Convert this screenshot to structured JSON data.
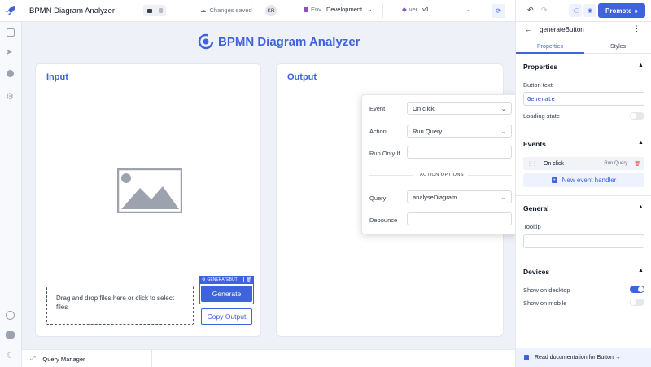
{
  "app": {
    "title": "BPMN Diagram Analyzer",
    "changes_status": "Changes saved",
    "user_initials": "KR"
  },
  "env": {
    "label": "Env",
    "value": "Development"
  },
  "version": {
    "label": "ver",
    "value": "v1"
  },
  "promote": {
    "label": "Promote"
  },
  "canvas": {
    "header_title": "BPMN Diagram Analyzer",
    "input_title": "Input",
    "output_title": "Output",
    "dropzone_text": "Drag and drop files here or click to select files",
    "component_tag": "GENERATEBUT",
    "generate_label": "Generate",
    "copy_label": "Copy Output"
  },
  "event_popover": {
    "event_label": "Event",
    "event_value": "On click",
    "action_label": "Action",
    "action_value": "Run Query",
    "run_only_if_label": "Run Only If",
    "action_options_label": "ACTION OPTIONS",
    "query_label": "Query",
    "query_value": "analyseDiagram",
    "debounce_label": "Debounce"
  },
  "bottom": {
    "query_manager": "Query Manager"
  },
  "inspector": {
    "component_name": "generateButton",
    "tabs": [
      {
        "label": "Properties"
      },
      {
        "label": "Styles"
      }
    ],
    "properties_title": "Properties",
    "button_text_label": "Button text",
    "button_text_value": "Generate",
    "loading_state_label": "Loading state",
    "events_title": "Events",
    "event_item": {
      "name": "On click",
      "action": "Run Query"
    },
    "new_event_label": "New event handler",
    "general_title": "General",
    "tooltip_label": "Tooltip",
    "devices_title": "Devices",
    "show_desktop_label": "Show on desktop",
    "show_mobile_label": "Show on mobile",
    "read_docs_label": "Read documentation for Button →"
  },
  "toggles": {
    "loading_state": false,
    "show_on_desktop": true,
    "show_on_mobile": false
  },
  "colors": {
    "accent": "#3e63dd",
    "danger": "#e5484d",
    "canvas_bg": "#eef1f7"
  },
  "icons": [
    "rocket-icon",
    "pages-icon",
    "inspector-icon",
    "bug-icon",
    "settings-icon",
    "chat-icon",
    "comments-icon",
    "theme-icon",
    "undo-icon",
    "redo-icon",
    "share-icon",
    "preview-icon",
    "back-arrow-icon",
    "more-icon",
    "trash-icon",
    "drag-handle-icon",
    "plus-icon",
    "expand-icon",
    "docs-icon",
    "sync-icon",
    "logo-icon",
    "image-placeholder-icon"
  ]
}
